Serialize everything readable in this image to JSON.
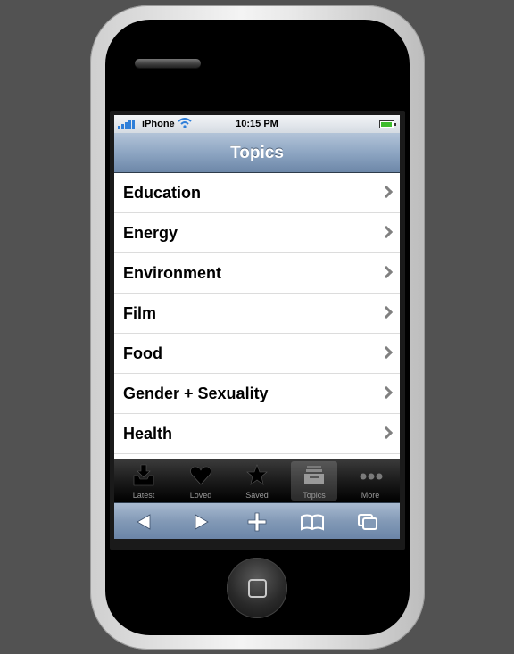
{
  "status_bar": {
    "carrier": "iPhone",
    "time": "10:15 PM"
  },
  "nav": {
    "title": "Topics"
  },
  "topics": [
    {
      "label": "Education"
    },
    {
      "label": "Energy"
    },
    {
      "label": "Environment"
    },
    {
      "label": "Film"
    },
    {
      "label": "Food"
    },
    {
      "label": "Gender + Sexuality"
    },
    {
      "label": "Health"
    }
  ],
  "tabbar": {
    "tabs": [
      {
        "label": "Latest",
        "icon": "inbox-icon"
      },
      {
        "label": "Loved",
        "icon": "heart-icon"
      },
      {
        "label": "Saved",
        "icon": "star-icon"
      },
      {
        "label": "Topics",
        "icon": "topics-tray-icon",
        "active": true
      },
      {
        "label": "More",
        "icon": "more-dots-icon"
      }
    ]
  },
  "browser_toolbar": {
    "buttons": [
      "back-arrow-icon",
      "forward-arrow-icon",
      "add-icon",
      "bookmarks-icon",
      "pages-icon"
    ]
  },
  "colors": {
    "nav_bar": "#8ea6c3",
    "tab_bar": "#1b1b1b",
    "signal": "#2f7fd9",
    "battery": "#3dbb2c"
  }
}
